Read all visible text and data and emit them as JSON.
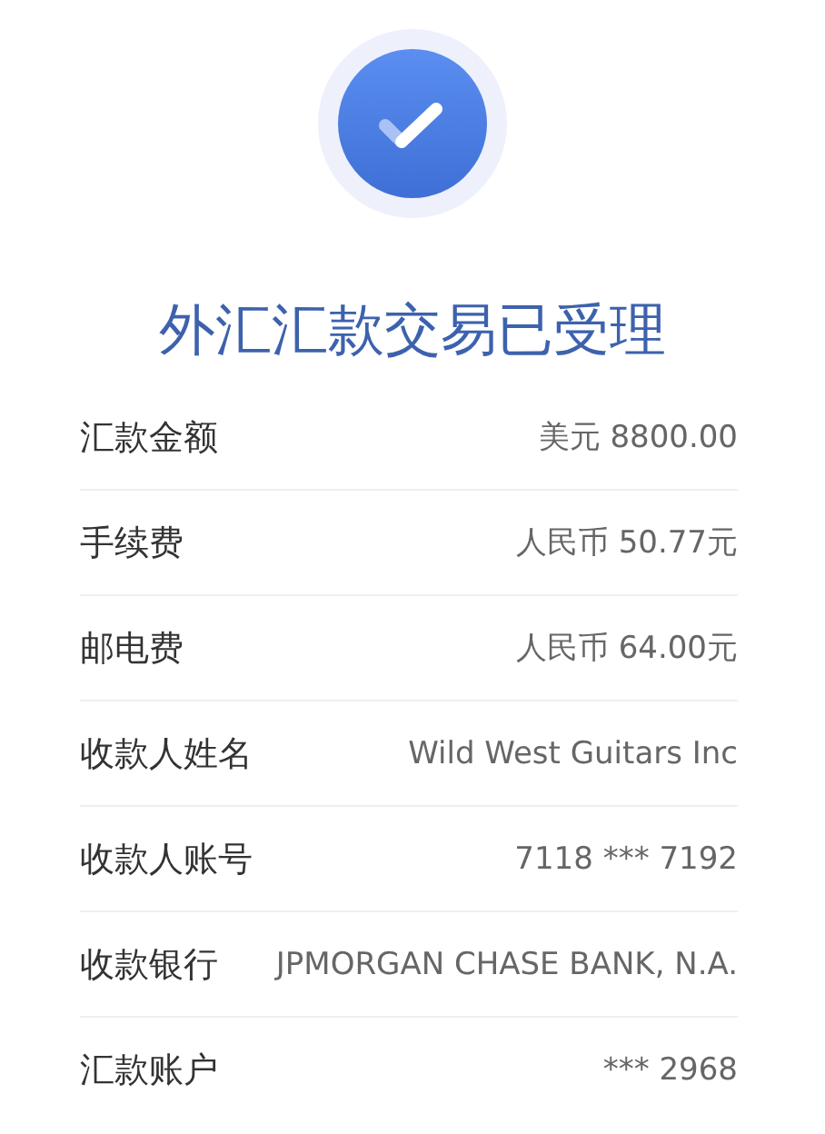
{
  "title": "外汇汇款交易已受理",
  "details": [
    {
      "label": "汇款金额",
      "value": "美元 8800.00"
    },
    {
      "label": "手续费",
      "value": "人民币 50.77元"
    },
    {
      "label": "邮电费",
      "value": "人民币 64.00元"
    },
    {
      "label": "收款人姓名",
      "value": "Wild West Guitars Inc"
    },
    {
      "label": "收款人账号",
      "value": "7118 *** 7192"
    },
    {
      "label": "收款银行",
      "value": "JPMORGAN CHASE BANK, N.A."
    },
    {
      "label": "汇款账户",
      "value": "*** 2968"
    }
  ]
}
